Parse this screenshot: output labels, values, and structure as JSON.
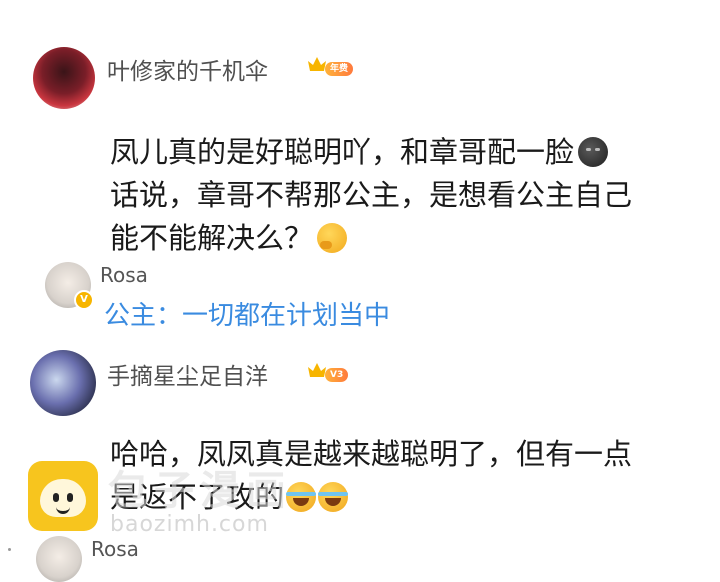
{
  "comments": [
    {
      "username": "叶修家的千机伞",
      "level_badge": "年费",
      "lines": [
        "凤儿真的是好聪明吖，和章哥配一脸",
        "话说，章哥不帮那公主，是想看公主自己",
        "能不能解决么？"
      ],
      "emojis": [
        "moon-face",
        "thinking-face"
      ]
    },
    {
      "username": "手摘星尘足自洋",
      "level_badge": "V3",
      "lines": [
        "哈哈，凤凤真是越来越聪明了，但有一点",
        "是返不了攻的"
      ],
      "emojis": [
        "laughing-tears",
        "laughing-tears"
      ]
    }
  ],
  "replies": [
    {
      "username": "Rosa",
      "verified_badge": "V",
      "text": "公主：一切都在计划当中"
    },
    {
      "username": "Rosa"
    }
  ],
  "watermark": {
    "text": "包子漫画",
    "url": "baozimh.com"
  },
  "colors": {
    "reply_link": "#3a8be0",
    "crown": "#f7b500",
    "watermark_logo": "#f7c51e"
  }
}
